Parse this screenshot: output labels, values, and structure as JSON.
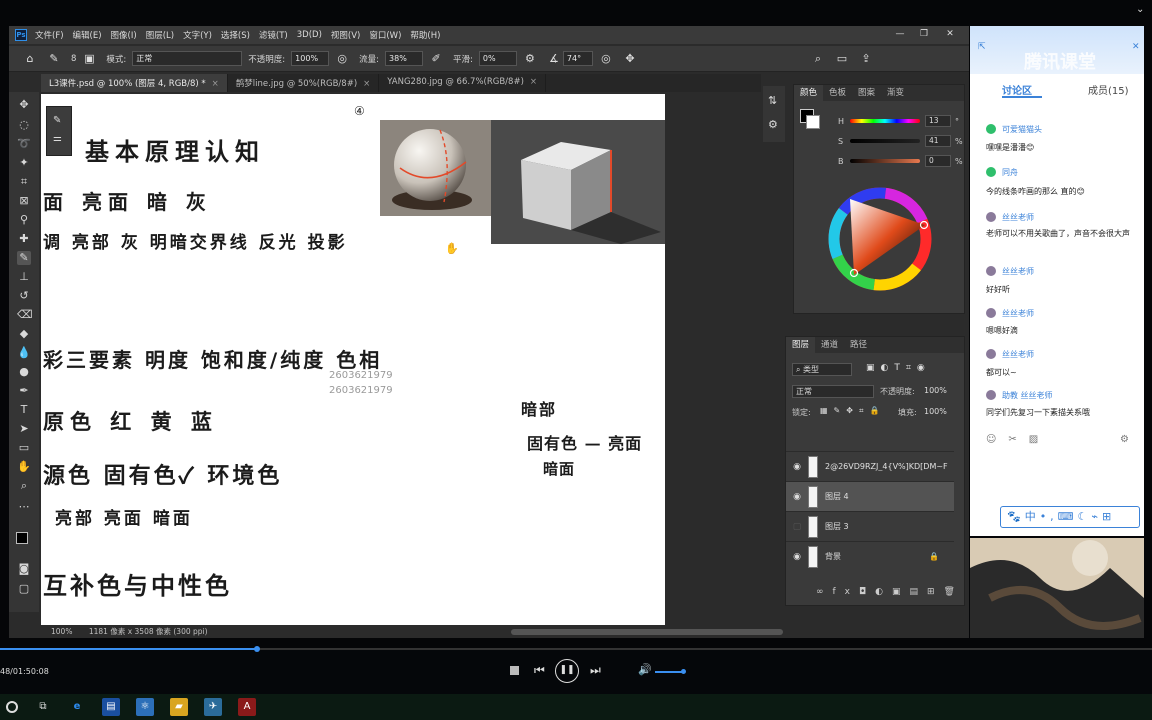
{
  "photoshop": {
    "menu": [
      "文件(F)",
      "编辑(E)",
      "图像(I)",
      "图层(L)",
      "文字(Y)",
      "选择(S)",
      "滤镜(T)",
      "3D(D)",
      "视图(V)",
      "窗口(W)",
      "帮助(H)"
    ],
    "options": {
      "brush_size": "8",
      "mode_label": "模式:",
      "mode_value": "正常",
      "opacity_label": "不透明度:",
      "opacity_value": "100%",
      "flow_label": "流量:",
      "flow_value": "38%",
      "smooth_label": "平滑:",
      "smooth_value": "0%",
      "angle_value": "74°"
    },
    "tabs": [
      {
        "label": "L3课件.psd @ 100% (图层 4, RGB/8) *",
        "active": true
      },
      {
        "label": "鹊梦line.jpg @ 50%(RGB/8#)",
        "active": false
      },
      {
        "label": "YANG280.jpg @ 66.7%(RGB/8#)",
        "active": false
      }
    ],
    "canvas_lines": [
      "基本原理认知",
      "面  亮面  暗  灰",
      "调  亮部 灰  明暗交界线  反光  投影",
      "彩三要素   明度  饱和度/纯度  色相",
      "原色   红  黄  蓝",
      "源色        固有色✓       环境色",
      "亮部        亮面          暗面",
      "互补色与中性色",
      "暗部",
      "固有色 — 亮面",
      "暗面"
    ],
    "watermark": [
      "2603621979",
      "2603621979"
    ],
    "status": {
      "zoom": "100%",
      "doc_size": "1181 像素 x 3508 像素 (300 ppi)"
    },
    "color_panel": {
      "tabs": [
        "颜色",
        "色板",
        "图案",
        "渐变"
      ],
      "h_label": "H",
      "h_value": "13",
      "h_unit": "°",
      "s_label": "S",
      "s_value": "41",
      "s_unit": "%",
      "b_label": "B",
      "b_value": "0",
      "b_unit": "%"
    },
    "layers_panel": {
      "tabs": [
        "图层",
        "通道",
        "路径"
      ],
      "filter": "类型",
      "blend_mode": "正常",
      "opacity_label": "不透明度:",
      "opacity_value": "100%",
      "lock_label": "锁定:",
      "fill_label": "填充:",
      "fill_value": "100%",
      "layers": [
        {
          "name": "2@26VD9RZJ_4{V%]KD[DM~F",
          "visible": true,
          "selected": false
        },
        {
          "name": "图层 4",
          "visible": true,
          "selected": true
        },
        {
          "name": "图层 3",
          "visible": false,
          "selected": false
        },
        {
          "name": "背景",
          "visible": true,
          "selected": false,
          "locked": true
        }
      ]
    }
  },
  "chat": {
    "brand": "腾讯课堂",
    "tab_discussion": "讨论区",
    "tab_members": "成员(15)",
    "messages": [
      {
        "name": "可爱猫猫头",
        "text": "嘿嘿是潘潘😊",
        "color": "#2fbf6c"
      },
      {
        "name": "同舟",
        "text": "今的线条咋画的那么 直的😊",
        "color": "#2fbf6c"
      },
      {
        "name": "丝丝老师",
        "text": "老师可以不用关歌曲了，声音不会很大声",
        "color": "#8a7a9a"
      },
      {
        "name": "丝丝老师",
        "text": "好好听",
        "color": "#8a7a9a"
      },
      {
        "name": "丝丝老师",
        "text": "嗯嗯好滴",
        "color": "#8a7a9a"
      },
      {
        "name": "丝丝老师",
        "text": "都可以~",
        "color": "#8a7a9a"
      },
      {
        "name": "助教 丝丝老师",
        "text": "同学们先复习一下素描关系哦",
        "color": "#8a7a9a"
      }
    ]
  },
  "player": {
    "time": "48/01:50:08",
    "progress": 0.223
  },
  "colors": {
    "ps_bg": "#2b2b2b",
    "accent_blue": "#3b82d8",
    "progress": "#3a8ff0"
  }
}
